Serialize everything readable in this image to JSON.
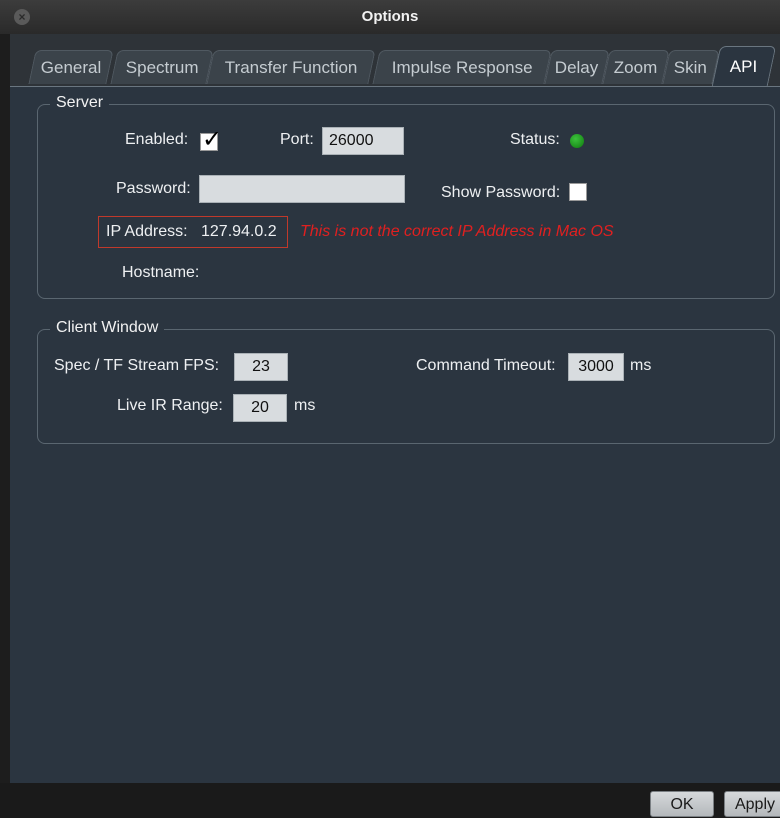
{
  "window": {
    "title": "Options"
  },
  "tabs": [
    {
      "label": "General"
    },
    {
      "label": "Spectrum"
    },
    {
      "label": "Transfer Function"
    },
    {
      "label": "Impulse Response"
    },
    {
      "label": "Delay"
    },
    {
      "label": "Zoom"
    },
    {
      "label": "Skin"
    },
    {
      "label": "API",
      "active": true
    }
  ],
  "server": {
    "legend": "Server",
    "enabled_label": "Enabled:",
    "enabled_checked": true,
    "port_label": "Port:",
    "port_value": "26000",
    "status_label": "Status:",
    "status_color": "#22a022",
    "password_label": "Password:",
    "password_value": "",
    "show_password_label": "Show Password:",
    "show_password_checked": false,
    "ip_label": "IP Address:",
    "ip_value": "127.94.0.2",
    "ip_warning": "This is not the correct IP Address in Mac OS",
    "hostname_label": "Hostname:",
    "hostname_value": ""
  },
  "client": {
    "legend": "Client Window",
    "fps_label": "Spec / TF Stream FPS:",
    "fps_value": "23",
    "timeout_label": "Command Timeout:",
    "timeout_value": "3000",
    "timeout_unit": "ms",
    "ir_label": "Live IR Range:",
    "ir_value": "20",
    "ir_unit": "ms"
  },
  "buttons": {
    "ok": "OK",
    "apply": "Apply"
  },
  "colors": {
    "warning": "#e02020",
    "panel": "#2b3540"
  }
}
